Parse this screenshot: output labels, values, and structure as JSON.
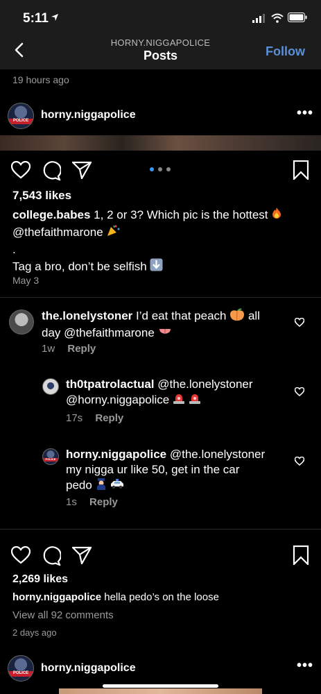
{
  "status": {
    "time": "5:11"
  },
  "nav": {
    "subtitle": "HORNY.NIGGAPOLICE",
    "title": "Posts",
    "follow": "Follow"
  },
  "prev_post": {
    "time_ago": "19 hours ago"
  },
  "post1": {
    "username": "horny.niggapolice",
    "likes": "7,543 likes",
    "caption_user": "college.babes",
    "caption_text": "1, 2 or 3? Which pic is the hottest",
    "caption_mention": "@thefaithmarone",
    "caption_dot": ".",
    "caption_tag": "Tag a bro, don’t be selfish",
    "date": "May 3",
    "comments": [
      {
        "username": "the.lonelystoner",
        "text_a": "I’d eat that peach",
        "text_b": "all",
        "text_c": "day @thefaithmarone",
        "age": "1w",
        "reply": "Reply"
      },
      {
        "username": "th0tpatrolactual",
        "text_a": "@the.lonelystoner",
        "text_b": "@horny.niggapolice",
        "age": "17s",
        "reply": "Reply"
      },
      {
        "username": "horny.niggapolice",
        "text_a": "@the.lonelystoner",
        "text_b": "my nigga ur like 50, get in the car",
        "text_c": "pedo",
        "age": "1s",
        "reply": "Reply"
      }
    ]
  },
  "post2": {
    "likes": "2,269 likes",
    "caption_user": "horny.niggapolice",
    "caption_text": "hella pedo’s on the loose",
    "view_all": "View all 92 comments",
    "time_ago": "2 days ago"
  },
  "post3": {
    "username": "horny.niggapolice"
  },
  "avatar_badge": "POLICE",
  "colors": {
    "accent": "#5b8fd8",
    "carousel_active": "#3897f0",
    "background": "#000000"
  },
  "icons": [
    "back-chevron-icon",
    "heart-icon",
    "comment-icon",
    "share-icon",
    "bookmark-icon",
    "more-dots-icon"
  ]
}
